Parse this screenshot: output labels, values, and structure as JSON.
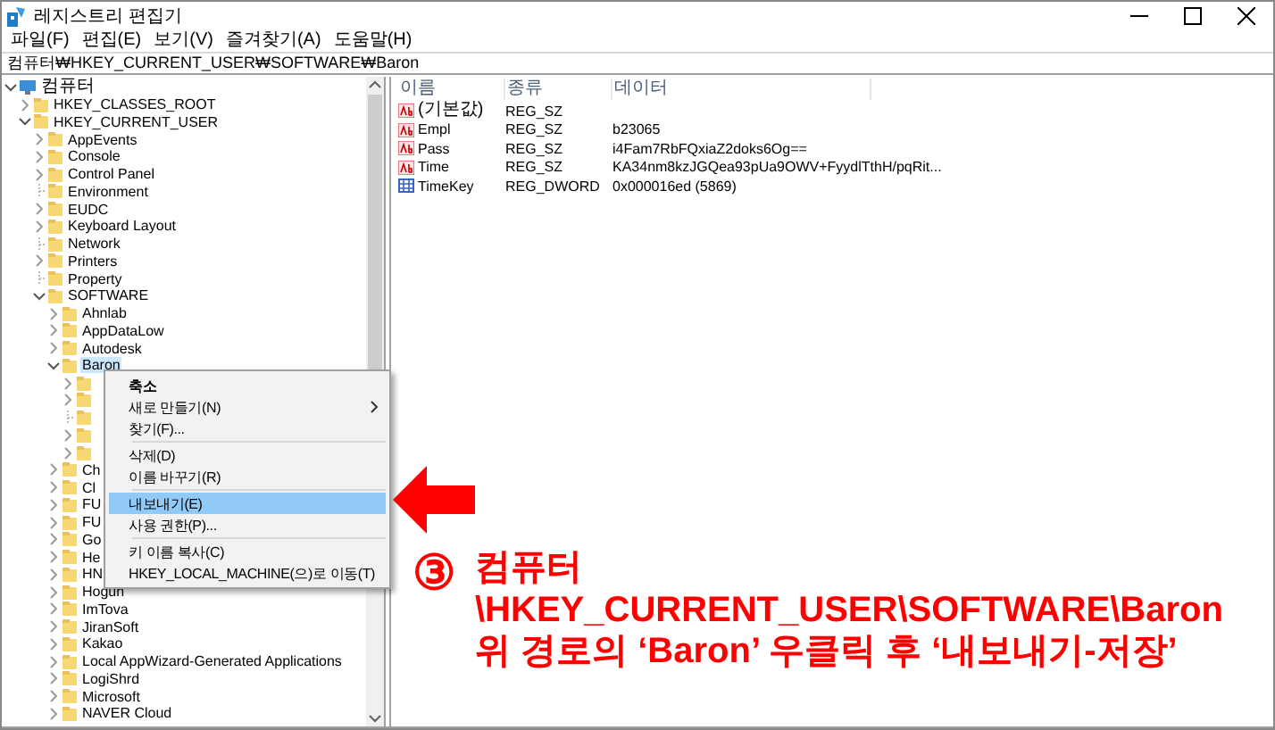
{
  "window": {
    "title": "레지스트리 편집기"
  },
  "menu_bar": [
    "파일(F)",
    "편집(E)",
    "보기(V)",
    "즐겨찾기(A)",
    "도움말(H)"
  ],
  "address": "컴퓨터₩HKEY_CURRENT_USER₩SOFTWARE₩Baron",
  "tree": {
    "label": "컴퓨터",
    "kind": "computer",
    "expanded": true,
    "has_children": true,
    "selected": false,
    "children": [
      {
        "label": "HKEY_CLASSES_ROOT",
        "expanded": false,
        "has_children": true,
        "selected": false
      },
      {
        "label": "HKEY_CURRENT_USER",
        "expanded": true,
        "has_children": true,
        "selected": false,
        "children": [
          {
            "label": "AppEvents",
            "expanded": false,
            "has_children": true,
            "selected": false
          },
          {
            "label": "Console",
            "expanded": false,
            "has_children": true,
            "selected": false
          },
          {
            "label": "Control Panel",
            "expanded": false,
            "has_children": true,
            "selected": false
          },
          {
            "label": "Environment",
            "has_children": false,
            "selected": false
          },
          {
            "label": "EUDC",
            "expanded": false,
            "has_children": true,
            "selected": false
          },
          {
            "label": "Keyboard Layout",
            "expanded": false,
            "has_children": true,
            "selected": false
          },
          {
            "label": "Network",
            "has_children": false,
            "selected": false
          },
          {
            "label": "Printers",
            "expanded": false,
            "has_children": true,
            "selected": false
          },
          {
            "label": "Property",
            "has_children": false,
            "selected": false
          },
          {
            "label": "SOFTWARE",
            "expanded": true,
            "has_children": true,
            "selected": false,
            "children": [
              {
                "label": "Ahnlab",
                "expanded": false,
                "has_children": true,
                "selected": false
              },
              {
                "label": "AppDataLow",
                "expanded": false,
                "has_children": true,
                "selected": false
              },
              {
                "label": "Autodesk",
                "expanded": false,
                "has_children": true,
                "selected": false
              },
              {
                "label": "Baron",
                "expanded": true,
                "has_children": true,
                "selected": true,
                "children": [
                  {
                    "expanded": false,
                    "has_children": true
                  },
                  {
                    "expanded": false,
                    "has_children": true
                  },
                  {
                    "has_children": false
                  },
                  {
                    "expanded": false,
                    "has_children": true
                  },
                  {
                    "expanded": false,
                    "has_children": true
                  }
                ]
              },
              {
                "label": "Ch",
                "expanded": false,
                "has_children": true,
                "selected": false
              },
              {
                "label": "Cl",
                "expanded": false,
                "has_children": true,
                "selected": false
              },
              {
                "label": "FU",
                "expanded": false,
                "has_children": true,
                "selected": false
              },
              {
                "label": "FU",
                "expanded": false,
                "has_children": true,
                "selected": false
              },
              {
                "label": "Go",
                "expanded": false,
                "has_children": true,
                "selected": false
              },
              {
                "label": "He",
                "expanded": false,
                "has_children": true,
                "selected": false
              },
              {
                "label": "HN",
                "expanded": false,
                "has_children": true,
                "selected": false
              },
              {
                "label": "Hogun",
                "expanded": false,
                "has_children": true,
                "selected": false
              },
              {
                "label": "ImTova",
                "expanded": false,
                "has_children": true,
                "selected": false
              },
              {
                "label": "JiranSoft",
                "expanded": false,
                "has_children": true,
                "selected": false
              },
              {
                "label": "Kakao",
                "expanded": false,
                "has_children": true,
                "selected": false
              },
              {
                "label": "Local AppWizard-Generated Applications",
                "expanded": false,
                "has_children": true,
                "selected": false
              },
              {
                "label": "LogiShrd",
                "expanded": false,
                "has_children": true,
                "selected": false
              },
              {
                "label": "Microsoft",
                "expanded": false,
                "has_children": true,
                "selected": false
              },
              {
                "label": "NAVER Cloud",
                "expanded": false,
                "has_children": true,
                "selected": false
              }
            ]
          }
        ]
      }
    ]
  },
  "values": {
    "columns": [
      "이름",
      "종류",
      "데이터"
    ],
    "rows": [
      {
        "kind": "string",
        "name": "(기본값)",
        "type": "REG_SZ"
      },
      {
        "kind": "string",
        "name": "Empl",
        "type": "REG_SZ",
        "data": "b23065"
      },
      {
        "kind": "string",
        "name": "Pass",
        "type": "REG_SZ",
        "data": "i4Fam7RbFQxiaZ2doks6Og=="
      },
      {
        "kind": "string",
        "name": "Time",
        "type": "REG_SZ",
        "data": "KA34nm8kzJGQea93pUa9OWV+FyydlTthH/pqRit..."
      },
      {
        "kind": "dword",
        "name": "TimeKey",
        "type": "REG_DWORD",
        "data": "0x000016ed (5869)"
      }
    ]
  },
  "context_menu": [
    {
      "kind": "item",
      "label": "축소",
      "default": true,
      "submenu": false,
      "selected": false
    },
    {
      "kind": "item",
      "label": "새로 만들기(N)",
      "default": false,
      "submenu": true,
      "selected": false
    },
    {
      "kind": "item",
      "label": "찾기(F)...",
      "default": false,
      "submenu": false,
      "selected": false
    },
    {
      "kind": "separator"
    },
    {
      "kind": "item",
      "label": "삭제(D)",
      "default": false,
      "submenu": false,
      "selected": false
    },
    {
      "kind": "item",
      "label": "이름 바꾸기(R)",
      "default": false,
      "submenu": false,
      "selected": false
    },
    {
      "kind": "separator"
    },
    {
      "kind": "item",
      "label": "내보내기(E)",
      "default": false,
      "submenu": false,
      "selected": true
    },
    {
      "kind": "item",
      "label": "사용 권한(P)...",
      "default": false,
      "submenu": false,
      "selected": false
    },
    {
      "kind": "separator"
    },
    {
      "kind": "item",
      "label": "키 이름 복사(C)",
      "default": false,
      "submenu": false,
      "selected": false
    },
    {
      "kind": "item",
      "label": "HKEY_LOCAL_MACHINE(으)로 이동(T)",
      "default": false,
      "submenu": false,
      "selected": false
    }
  ],
  "annotation": {
    "step": "③",
    "lines": [
      "컴퓨터",
      "\\HKEY_CURRENT_USER\\SOFTWARE\\Baron",
      "위 경로의 ‘Baron’ 우클릭 후 ‘내보내기-저장’"
    ]
  }
}
